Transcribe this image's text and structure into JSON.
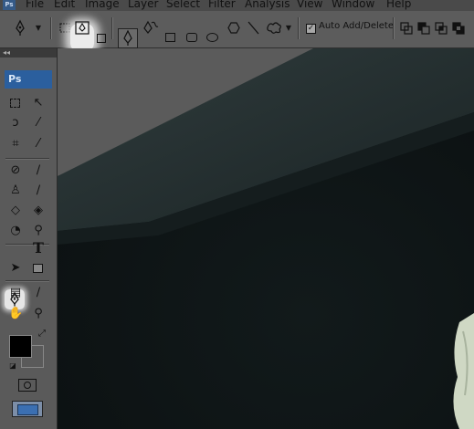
{
  "app": {
    "logo": "Ps"
  },
  "menu": [
    "File",
    "Edit",
    "Image",
    "Layer",
    "Select",
    "Filter",
    "Analysis",
    "View",
    "Window",
    "Help"
  ],
  "options_bar": {
    "auto_add_delete": {
      "label": "Auto Add/Delete",
      "checked": true
    },
    "active_mode": "paths",
    "tools": [
      "pen-tool-icon",
      "shape-layers-icon",
      "paths-icon",
      "fill-pixels-icon",
      "pen-icon",
      "freeform-pen-icon",
      "rectangle-icon",
      "rounded-rectangle-icon",
      "ellipse-icon",
      "polygon-icon",
      "line-icon",
      "custom-shape-icon",
      "add-to-path-icon",
      "subtract-from-path-icon",
      "intersect-path-icon",
      "exclude-overlap-icon"
    ]
  },
  "tools_panel": {
    "badge": "Ps",
    "selected_tool": "pen-tool",
    "type_tool_glyph": "T",
    "foreground_color": "#000000",
    "background_color": "#5a5a5a"
  },
  "colors": {
    "ui_gray": "#5c5c5c",
    "canvas": "#0f1617",
    "wall": "#2a3637"
  }
}
